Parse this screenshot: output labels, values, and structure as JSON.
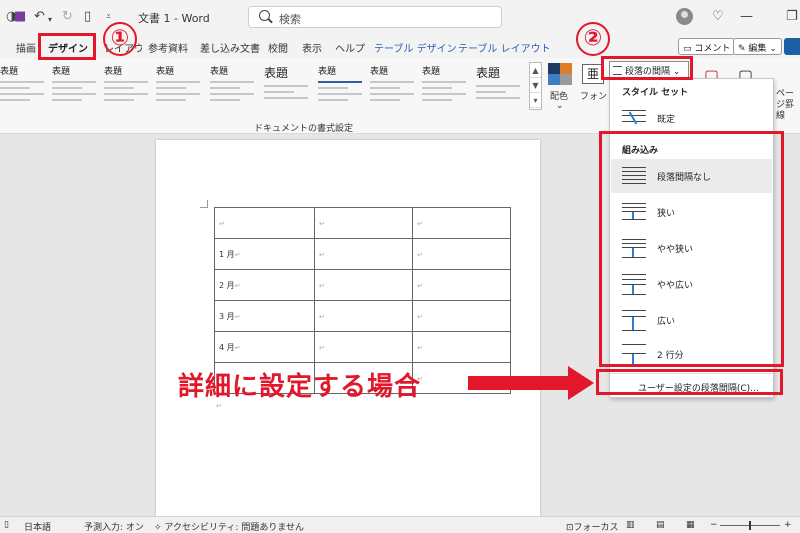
{
  "titlebar": {
    "doc_title": "文書 1  -  Word",
    "search_placeholder": "検索"
  },
  "tabs": [
    {
      "label": "描画"
    },
    {
      "label": "デザイン"
    },
    {
      "label": "レイアウト"
    },
    {
      "label": "参考資料"
    },
    {
      "label": "差し込み文書"
    },
    {
      "label": "校閲"
    },
    {
      "label": "表示"
    },
    {
      "label": "ヘルプ"
    },
    {
      "label": "テーブル デザイン"
    },
    {
      "label": "テーブル レイアウト"
    }
  ],
  "tab_right": {
    "comment_label": "コメント",
    "edit_label": "編集"
  },
  "ribbon": {
    "style_samples": [
      {
        "label": "表題"
      },
      {
        "label": "表題"
      },
      {
        "label": "表題"
      },
      {
        "label": "表題"
      },
      {
        "label": "表題"
      },
      {
        "label": "表題"
      },
      {
        "label": "表題"
      },
      {
        "label": "表題"
      },
      {
        "label": "表題"
      },
      {
        "label": "表題"
      }
    ],
    "group_caption": "ドキュメントの書式設定",
    "colors_label": "配色",
    "fonts_label": "フォント",
    "para_spacing_label": "段落の間隔",
    "page_border_label": "ページ罫線"
  },
  "document": {
    "rows": [
      [
        "",
        "",
        ""
      ],
      [
        "1 月",
        "",
        ""
      ],
      [
        "2 月",
        "",
        ""
      ],
      [
        "3 月",
        "",
        ""
      ],
      [
        "4 月",
        "",
        ""
      ],
      [
        "",
        "",
        ""
      ]
    ]
  },
  "dropdown": {
    "section_style_set": "スタイル セット",
    "default_label": "既定",
    "section_builtin": "組み込み",
    "items": [
      {
        "label": "段落間隔なし"
      },
      {
        "label": "狭い"
      },
      {
        "label": "やや狭い"
      },
      {
        "label": "やや広い"
      },
      {
        "label": "広い"
      },
      {
        "label": "2 行分"
      }
    ],
    "custom_label": "ユーザー設定の段落間隔(C)..."
  },
  "annotations": {
    "step1": "①",
    "step2": "②",
    "note": "詳細に設定する場合"
  },
  "statusbar": {
    "language": "日本語",
    "predictive": "予測入力: オン",
    "accessibility": "アクセシビリティ: 問題ありません",
    "focus": "フォーカス"
  },
  "colors": {
    "accent_red": "#e3172b",
    "word_blue": "#2b5fb4",
    "active_underline": "#1e5f3c"
  }
}
